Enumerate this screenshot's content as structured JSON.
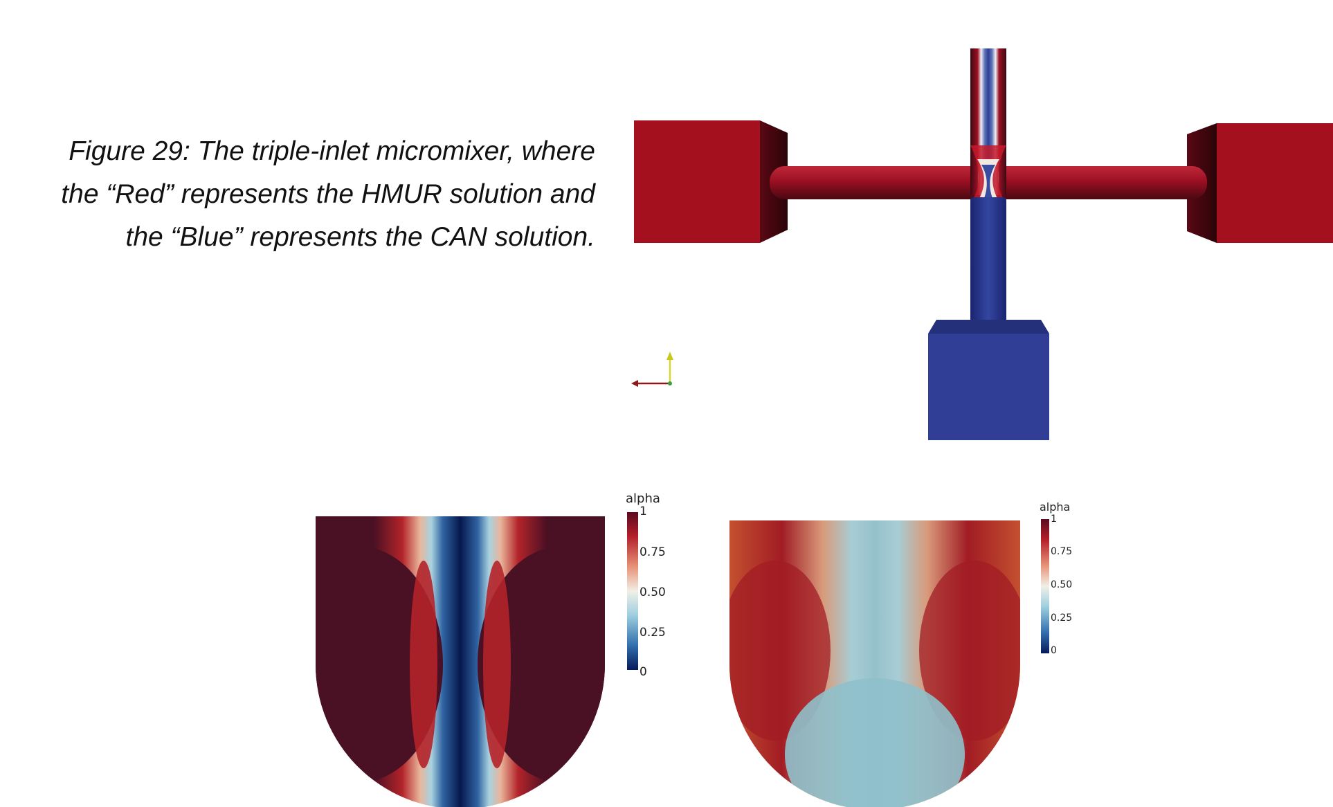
{
  "caption": {
    "line1": "Figure 29: The triple-inlet micromixer, where",
    "line2": "the “Red” represents the HMUR solution and",
    "line3": "the “Blue” represents the CAN solution."
  },
  "colors": {
    "red_solution": "#9a1022",
    "blue_solution": "#2f3e94",
    "dark_red": "#4a1024",
    "dark_blue": "#06174e"
  },
  "colorbars": [
    {
      "title": "alpha",
      "ticks": [
        "1",
        "0.75",
        "0.50",
        "0.25",
        "0"
      ]
    },
    {
      "title": "alpha",
      "ticks": [
        "1",
        "0.75",
        "0.50",
        "0.25",
        "0"
      ]
    }
  ],
  "icons": {
    "axes": "orientation-axes-icon"
  }
}
